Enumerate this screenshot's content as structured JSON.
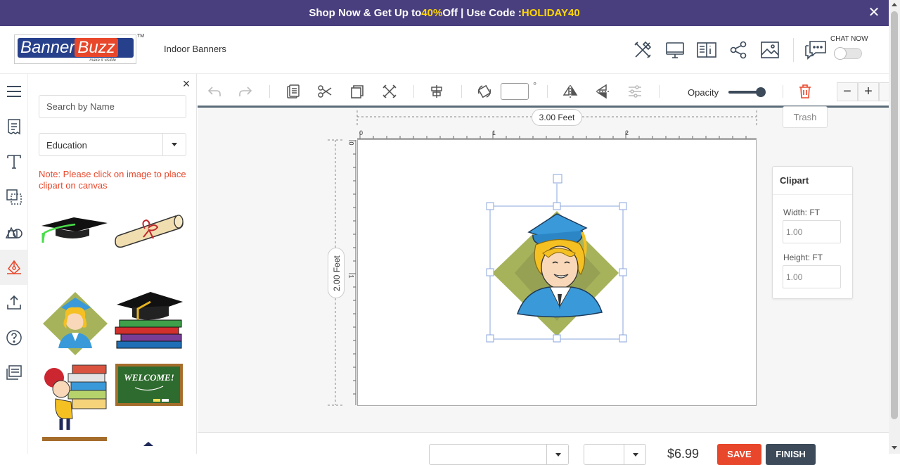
{
  "promo": {
    "part1": "Shop Now & Get Up to ",
    "highlight_pct": "40%",
    "part2": " Off | Use Code : ",
    "code": "HOLIDAY40",
    "close": "✕"
  },
  "header": {
    "logo": {
      "banner": "Banner",
      "buzz": "Buzz",
      "tagline": "make it visible",
      "tm": "TM"
    },
    "product_title": "Indoor Banners",
    "icons": [
      "design-tools-icon",
      "monitor-preview-icon",
      "specs-icon",
      "share-icon",
      "image-icon"
    ],
    "chat_label": "CHAT NOW",
    "chat_enabled": false
  },
  "leftbar": {
    "items": [
      "menu-icon",
      "template-icon",
      "text-icon",
      "shapes-icon",
      "clipart-icon",
      "pen-icon",
      "upload-icon",
      "help-icon",
      "layers-icon"
    ],
    "active": "pen-icon"
  },
  "panel": {
    "close": "×",
    "search_placeholder": "Search by Name",
    "category": "Education",
    "note": "Note: Please click on image to place clipart on canvas",
    "cliparts": [
      "graduation-cap",
      "diploma-scroll",
      "graduate-girl",
      "cap-on-books",
      "girl-carrying-books",
      "welcome-chalkboard"
    ]
  },
  "toolbar": {
    "rotation_value": "",
    "degree": "°",
    "opacity_label": "Opacity",
    "opacity": 1.0,
    "zoom_out": "−",
    "zoom_in": "+",
    "trash_tooltip": "Trash"
  },
  "canvas": {
    "width_label": "3.00 Feet",
    "height_label": "2.00 Feet",
    "ruler_h": [
      "0",
      "1",
      "2"
    ],
    "ruler_v": [
      "0",
      "1"
    ],
    "selected_clipart": "graduate-girl"
  },
  "properties": {
    "title": "Clipart",
    "width_label": "Width: FT",
    "width_value": "1.00",
    "height_label": "Height: FT",
    "height_value": "1.00"
  },
  "footer": {
    "price": "$6.99",
    "save": "SAVE",
    "finish": "FINISH"
  },
  "colors": {
    "promo_bg": "#4a3f7e",
    "accent_yellow": "#ffd700",
    "brand_orange": "#e8472b",
    "brand_blue": "#27408b",
    "dark": "#3c4a5a"
  }
}
